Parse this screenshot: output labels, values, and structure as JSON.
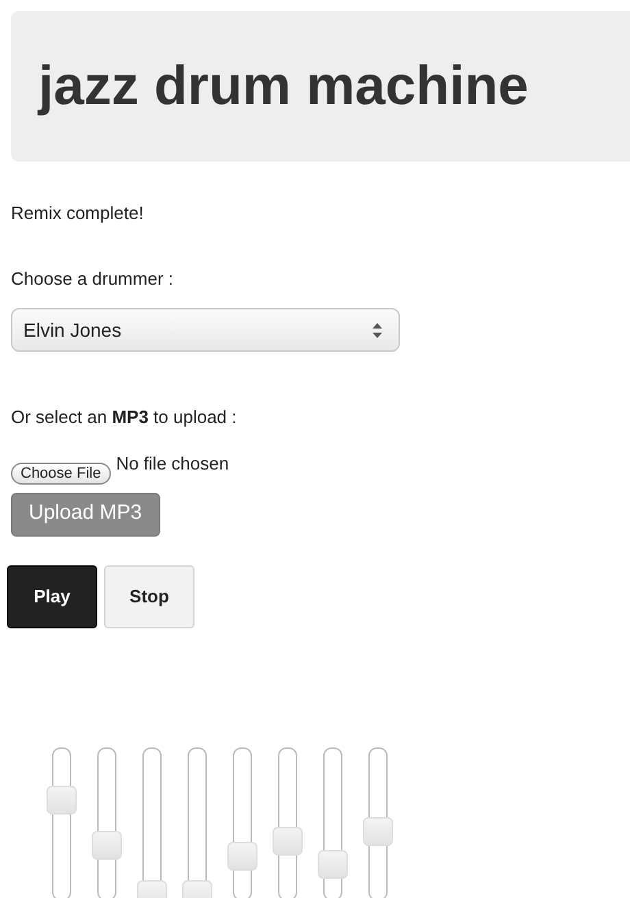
{
  "header": {
    "title": "jazz drum machine"
  },
  "status": "Remix complete!",
  "drummer": {
    "label": "Choose a drummer :",
    "value": "Elvin Jones"
  },
  "upload": {
    "label": "Or select an **MP3** to upload :",
    "choose_button": "Choose File",
    "file_status": "No file chosen",
    "upload_button": "Upload MP3"
  },
  "transport": [
    {
      "label": "Play",
      "selected": true
    },
    {
      "label": "Stop",
      "selected": false
    }
  ],
  "sliders": [
    {
      "level": 0.7
    },
    {
      "level": 0.36
    },
    {
      "level": 0
    },
    {
      "level": 0
    },
    {
      "level": 0.28
    },
    {
      "level": 0.39
    },
    {
      "level": 0.22
    },
    {
      "level": 0.46
    }
  ]
}
